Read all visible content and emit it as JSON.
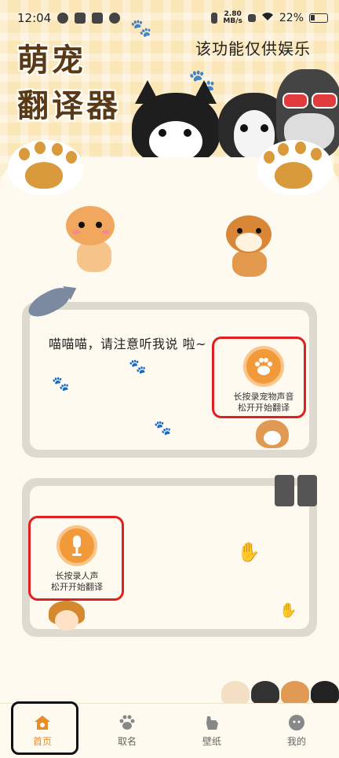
{
  "status_bar": {
    "time": "12:04",
    "net_speed_value": "2.80",
    "net_speed_unit": "MB/s",
    "battery": "22%"
  },
  "header": {
    "title_line1": "萌宠",
    "title_line2": "翻译器",
    "disclaimer": "该功能仅供娱乐"
  },
  "pet_translator": {
    "message": "喵喵喵，请注意听我说 啦~",
    "record_label_line1": "长按录宠物声音",
    "record_label_line2": "松开开始翻译",
    "record_icon": "paw-icon"
  },
  "human_translator": {
    "record_label_line1": "长按录人声",
    "record_label_line2": "松开开始翻译",
    "record_icon": "microphone-icon"
  },
  "bottom_nav": {
    "items": [
      {
        "label": "首页",
        "icon": "home-icon",
        "active": true
      },
      {
        "label": "取名",
        "icon": "paw-icon",
        "active": false
      },
      {
        "label": "壁纸",
        "icon": "dog-icon",
        "active": false
      },
      {
        "label": "我的",
        "icon": "profile-icon",
        "active": false
      }
    ]
  },
  "colors": {
    "accent": "#e98c2a",
    "highlight_red": "#e02020",
    "title_brown": "#5a3a16"
  }
}
